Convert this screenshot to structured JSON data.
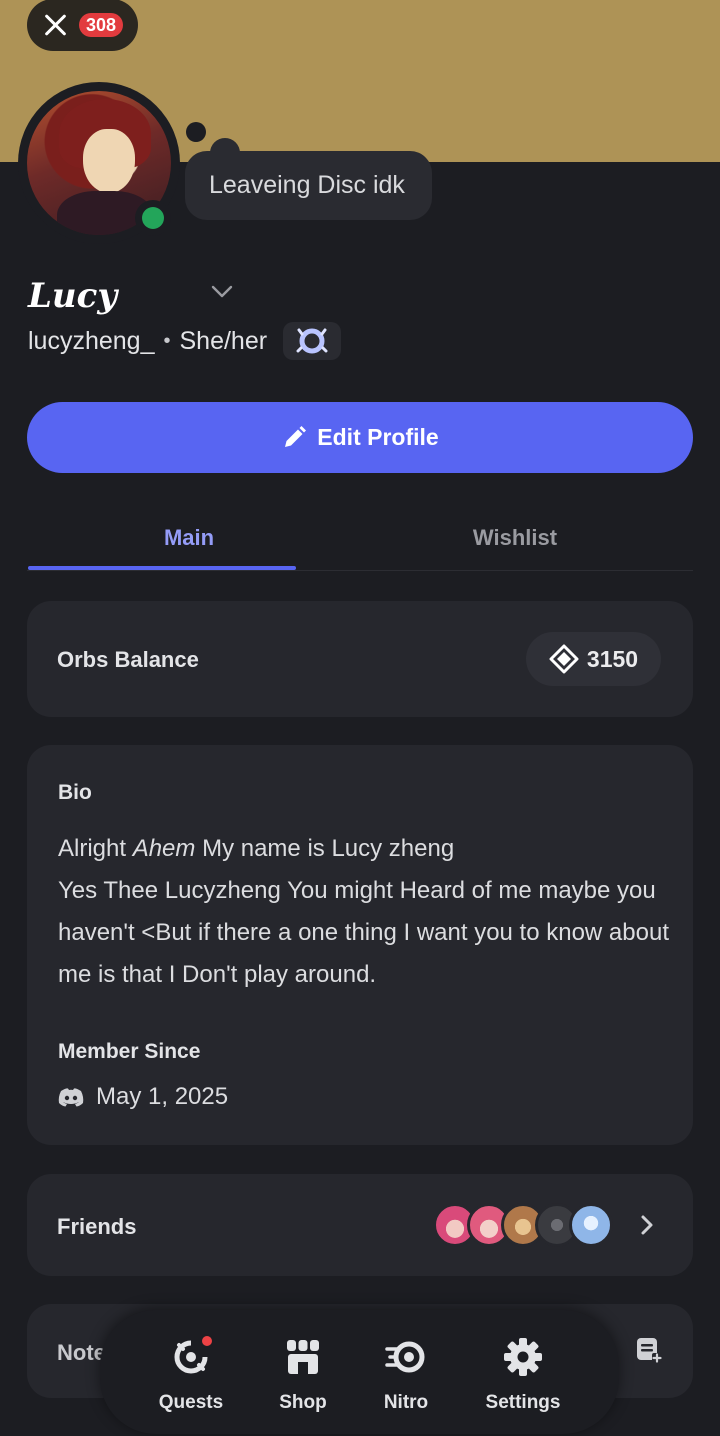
{
  "header": {
    "close_badge_count": "308",
    "custom_status": "Leaveing Disc idk"
  },
  "profile": {
    "display_name": "Lucy",
    "username": "lucyzheng_",
    "separator": "•",
    "pronouns": "She/her",
    "edit_button_label": "Edit Profile"
  },
  "tabs": [
    {
      "label": "Main",
      "selected": true
    },
    {
      "label": "Wishlist",
      "selected": false
    }
  ],
  "orbs": {
    "label": "Orbs Balance",
    "value": "3150"
  },
  "bio": {
    "heading": "Bio",
    "line1_a": "Alright ",
    "line1_em": "Ahem",
    "line1_b": " My name is Lucy zheng",
    "rest": "Yes Thee Lucyzheng You might Heard of me maybe you haven't <But if there a one thing I want you to know about me  is that  I Don't play around.",
    "member_since_heading": "Member Since",
    "member_since_date": "May 1, 2025"
  },
  "friends": {
    "label": "Friends",
    "avatar_colors": [
      "#d94a7a",
      "#e05a7e",
      "#b0784a",
      "#3a3b40",
      "#8fb6e8"
    ]
  },
  "notes": {
    "label": "Note"
  },
  "bottom_nav": [
    {
      "label": "Quests",
      "icon": "quests-icon",
      "has_notification": true
    },
    {
      "label": "Shop",
      "icon": "shop-icon"
    },
    {
      "label": "Nitro",
      "icon": "nitro-icon"
    },
    {
      "label": "Settings",
      "icon": "settings-icon"
    }
  ],
  "colors": {
    "banner": "#ae9356",
    "accent": "#5865f2",
    "online": "#23a55a",
    "background": "#1c1d22",
    "card": "#26272d"
  }
}
